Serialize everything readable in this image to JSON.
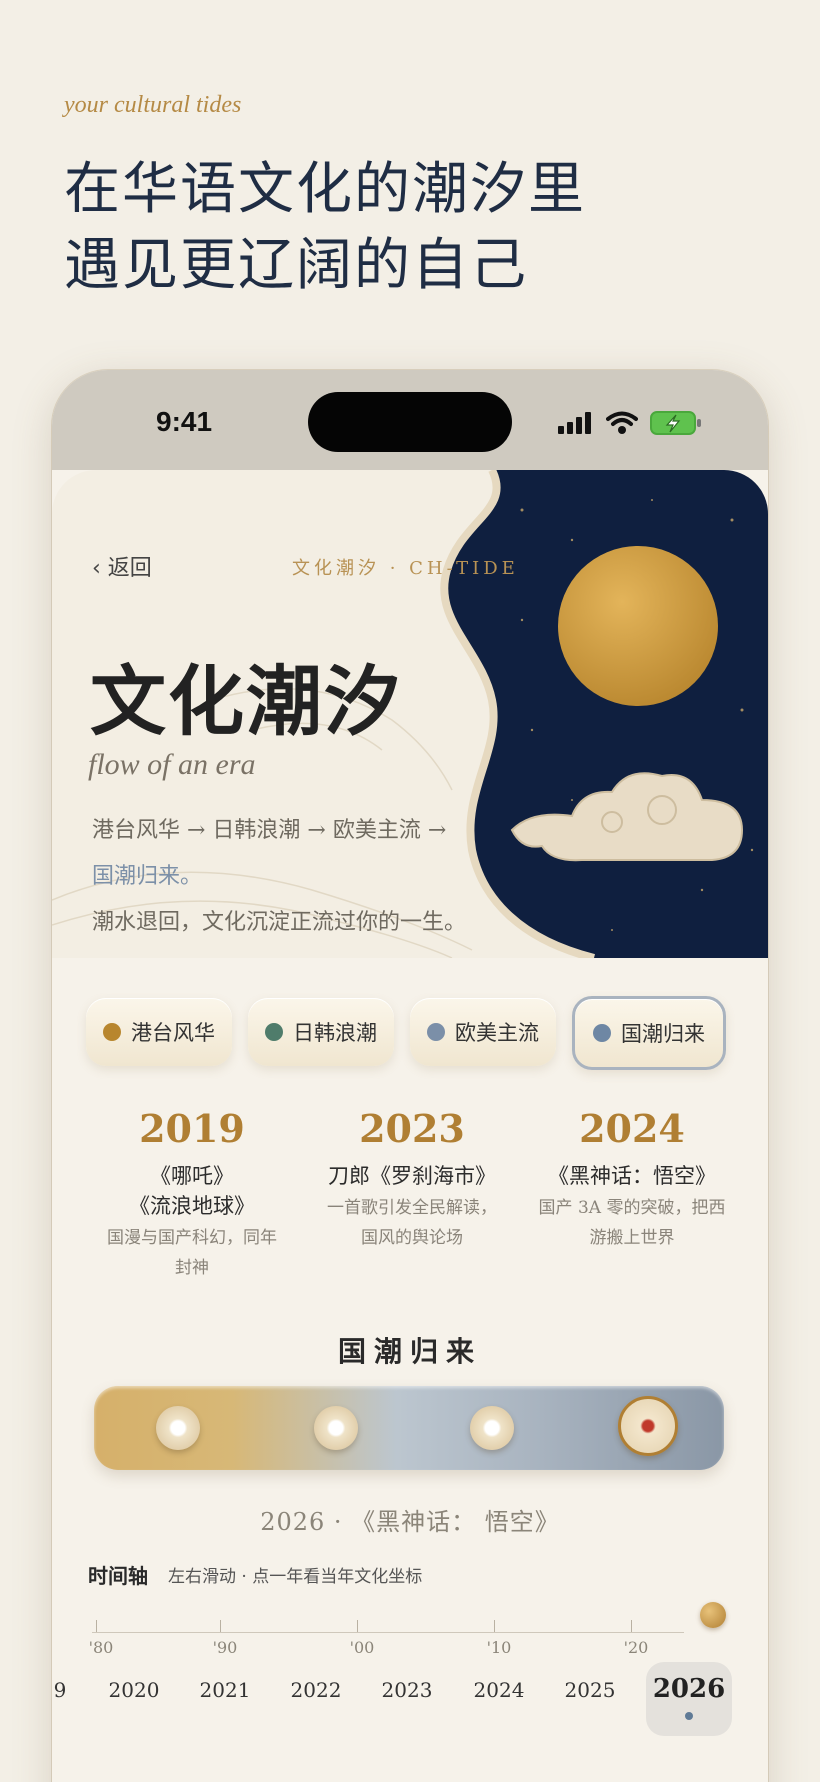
{
  "tagline": "your cultural tides",
  "headline": {
    "line1": "在华语文化的潮汐里",
    "line2": "遇见更辽阔的自己"
  },
  "status": {
    "time": "9:41"
  },
  "hero": {
    "back": "‹ 返回",
    "subtitle": "文化潮汐 · CH-TIDE",
    "title": "文化潮汐",
    "title_en": "flow of an era",
    "desc1": "港台风华 → 日韩浪潮 → 欧美主流 →",
    "desc_blue": "国潮归来。",
    "desc2": "潮水退回，文化沉淀正流过你的一生。"
  },
  "chips": [
    {
      "label": "港台风华",
      "color": "#b8862e"
    },
    {
      "label": "日韩浪潮",
      "color": "#4f7c6b"
    },
    {
      "label": "欧美主流",
      "color": "#7b8fa8"
    },
    {
      "label": "国潮归来",
      "color": "#6e87a4",
      "active": true
    }
  ],
  "years": [
    {
      "year": "2019",
      "title1": "《哪吒》",
      "title2": "《流浪地球》",
      "desc1": "国漫与国产科幻，同年",
      "desc2": "封神"
    },
    {
      "year": "2023",
      "title1": "刀郎《罗刹海市》",
      "title2": "",
      "desc1": "一首歌引发全民解读，",
      "desc2": "国风的舆论场"
    },
    {
      "year": "2024",
      "title1": "《黑神话：悟空》",
      "title2": "",
      "desc1": "国产 3A 零的突破，把西",
      "desc2": "游搬上世界"
    }
  ],
  "section_title": "国潮归来",
  "caption": "2026 · 《黑神话：  悟空》",
  "timeline": {
    "label": "时间轴",
    "hint": "左右滑动 · 点一年看当年文化坐标",
    "ticks": [
      "'80",
      "'90",
      "'00",
      "'10",
      "'20"
    ],
    "years": [
      "9",
      "2020",
      "2021",
      "2022",
      "2023",
      "2024",
      "2025"
    ],
    "selected": "2026"
  }
}
